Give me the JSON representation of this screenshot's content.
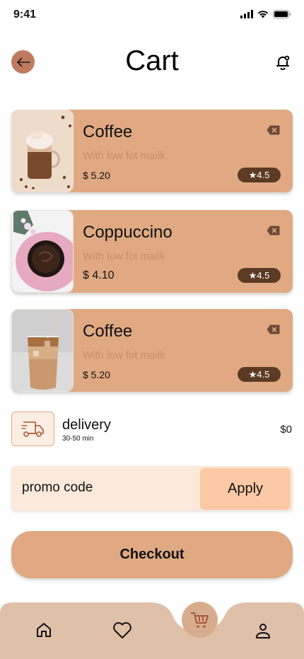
{
  "status_bar": {
    "time": "9:41"
  },
  "header": {
    "title": "Cart"
  },
  "cart_items": [
    {
      "name": "Coffee",
      "subtitle": "With low fot mailk",
      "price": "$ 5.20",
      "rating": "★4.5"
    },
    {
      "name": "Coppuccino",
      "subtitle": "With low fot mailk",
      "price": "$ 4.10",
      "rating": "★4.5"
    },
    {
      "name": "Coffee",
      "subtitle": "With low fot mailk",
      "price": "$ 5.20",
      "rating": "★4.5"
    }
  ],
  "delivery": {
    "label": "delivery",
    "time": "30-50 min",
    "price": "$0"
  },
  "promo": {
    "placeholder": "promo code",
    "value": "",
    "apply_label": "Apply"
  },
  "checkout": {
    "label": "Checkout"
  },
  "bottom_nav": {
    "items": [
      {
        "icon": "home-icon"
      },
      {
        "icon": "heart-icon"
      },
      {
        "icon": "cart-icon",
        "active": true
      },
      {
        "icon": "profile-icon"
      }
    ]
  },
  "colors": {
    "accent": "#e0a982",
    "accent_dark": "#5c3a24",
    "back_button": "#c07a5f",
    "promo_bg": "#fde9da",
    "apply_bg": "#fcc9a6",
    "nav_bg": "#dfc0a9"
  }
}
